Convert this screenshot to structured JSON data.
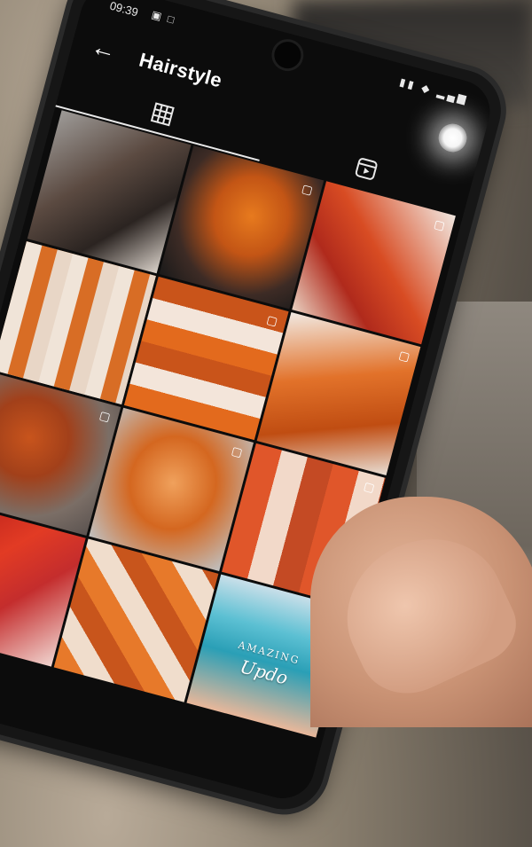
{
  "status_bar": {
    "time": "09:39",
    "left_icons": "▣ □",
    "right_icons": "▮▮ ◆ ▂▄▆"
  },
  "top_bar": {
    "title": "Hairstyle",
    "back_icon": "←"
  },
  "tabs": [
    {
      "name": "grid-icon",
      "active": true
    },
    {
      "name": "reels-icon",
      "active": false
    }
  ],
  "posts": [
    {
      "id": "p1",
      "type": "photo",
      "marker": ""
    },
    {
      "id": "p2",
      "type": "video",
      "marker": "▢"
    },
    {
      "id": "p3",
      "type": "collage",
      "marker": "▢"
    },
    {
      "id": "p4",
      "type": "collage",
      "marker": ""
    },
    {
      "id": "p5",
      "type": "collage",
      "marker": "▢"
    },
    {
      "id": "p6",
      "type": "photo",
      "marker": "▢"
    },
    {
      "id": "p7",
      "type": "photo",
      "marker": "▢"
    },
    {
      "id": "p8",
      "type": "photo",
      "marker": "▢"
    },
    {
      "id": "p9",
      "type": "collage",
      "marker": "▢"
    },
    {
      "id": "p10",
      "type": "photo",
      "marker": ""
    },
    {
      "id": "p11",
      "type": "collage",
      "marker": ""
    },
    {
      "id": "p12",
      "type": "photo",
      "marker": "▢",
      "overlay_line1": "AMAZING",
      "overlay_line2": "Updo"
    }
  ],
  "bottom": {
    "add_symbol": "+"
  }
}
